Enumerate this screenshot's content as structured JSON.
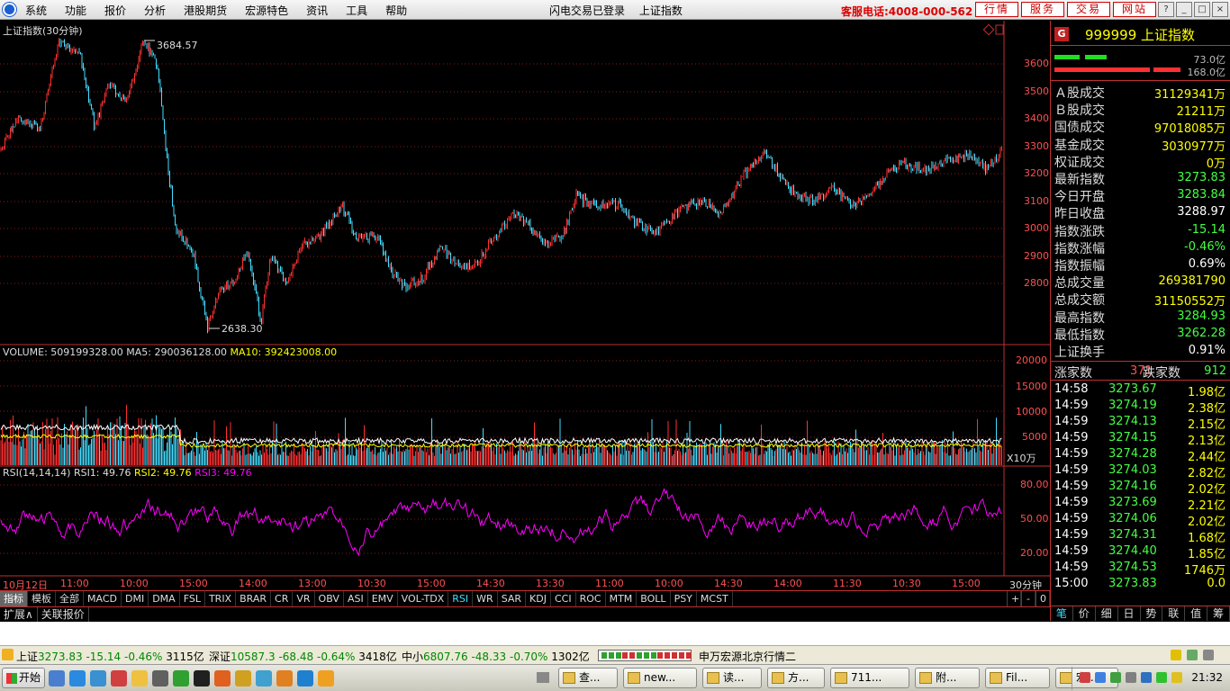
{
  "menu": {
    "items": [
      "系统",
      "功能",
      "报价",
      "分析",
      "港股期货",
      "宏源特色",
      "资讯",
      "工具",
      "帮助"
    ],
    "status": [
      "闪电交易已登录",
      "上证指数"
    ],
    "hotline": "客服电话:4008-000-562",
    "quick_buttons": [
      "行情",
      "服务",
      "交易",
      "网站"
    ],
    "window_controls": [
      "?",
      "_",
      "□",
      "×"
    ]
  },
  "chart": {
    "title": "上证指数(30分钟)",
    "price_axis": [
      "3600",
      "3500",
      "3400",
      "3300",
      "3200",
      "3100",
      "3000",
      "2900",
      "2800"
    ],
    "annotation_high": "3684.57",
    "annotation_low": "2638.30",
    "volume_header": {
      "prefix": "VOLUME: 509199328.00",
      "ma5": "MA5: 290036128.00",
      "ma10": "MA10: 392423008.00"
    },
    "volume_axis": [
      "20000",
      "15000",
      "10000",
      "5000"
    ],
    "volume_unit": "X10万",
    "rsi_header": {
      "prefix": "RSI(14,14,14)",
      "rsi1": "RSI1: 49.76",
      "rsi2": "RSI2: 49.76",
      "rsi3": "RSI3: 49.76"
    },
    "rsi_axis": [
      "80.00",
      "50.00",
      "20.00"
    ],
    "time_axis": [
      "10月12日",
      "11:00",
      "10:00",
      "15:00",
      "14:00",
      "13:00",
      "10:30",
      "15:00",
      "14:30",
      "13:30",
      "11:00",
      "10:00",
      "14:30",
      "14:00",
      "11:30",
      "10:30",
      "15:00"
    ],
    "period": "30分钟",
    "colors": {
      "up": "#ff3030",
      "down": "#44ddff",
      "ma5": "#ffffff",
      "ma10": "#ffff00",
      "rsi": "#ff00ff",
      "grid": "#8a1a1a"
    }
  },
  "indicators": {
    "tabs": [
      "指标",
      "模板",
      "全部",
      "MACD",
      "DMI",
      "DMA",
      "FSL",
      "TRIX",
      "BRAR",
      "CR",
      "VR",
      "OBV",
      "ASI",
      "EMV",
      "VOL-TDX",
      "RSI",
      "WR",
      "SAR",
      "KDJ",
      "CCI",
      "ROC",
      "MTM",
      "BOLL",
      "PSY",
      "MCST"
    ],
    "selected": "指标",
    "active": "RSI",
    "right_buttons": [
      "+",
      "-",
      "0"
    ]
  },
  "ext_tabs": [
    "扩展∧",
    "关联报价"
  ],
  "quote": {
    "code": "999999",
    "name": "上证指数",
    "buy_ratio": "73.0亿",
    "sell_ratio": "168.0亿",
    "rows": [
      {
        "k": "Ａ股成交",
        "v": "31129341万",
        "c": "yellow"
      },
      {
        "k": "Ｂ股成交",
        "v": "21211万",
        "c": "yellow"
      },
      {
        "k": "国债成交",
        "v": "97018085万",
        "c": "yellow"
      },
      {
        "k": "基金成交",
        "v": "3030977万",
        "c": "yellow"
      },
      {
        "k": "权证成交",
        "v": "0万",
        "c": "yellow"
      },
      {
        "k": "最新指数",
        "v": "3273.83",
        "c": "green"
      },
      {
        "k": "今日开盘",
        "v": "3283.84",
        "c": "green"
      },
      {
        "k": "昨日收盘",
        "v": "3288.97",
        "c": "white"
      },
      {
        "k": "指数涨跌",
        "v": "-15.14",
        "c": "green"
      },
      {
        "k": "指数涨幅",
        "v": "-0.46%",
        "c": "green"
      },
      {
        "k": "指数振幅",
        "v": "0.69%",
        "c": "white"
      },
      {
        "k": "总成交量",
        "v": "269381790",
        "c": "yellow"
      },
      {
        "k": "总成交额",
        "v": "31150552万",
        "c": "yellow"
      },
      {
        "k": "最高指数",
        "v": "3284.93",
        "c": "green"
      },
      {
        "k": "最低指数",
        "v": "3262.28",
        "c": "green"
      },
      {
        "k": "上证换手",
        "v": "0.91%",
        "c": "white"
      }
    ],
    "adv_label": "涨家数",
    "adv_value": "371",
    "dec_label": "跌家数",
    "dec_value": "912",
    "ticks": [
      {
        "t": "14:58",
        "p": "3273.67",
        "a": "1.98亿"
      },
      {
        "t": "14:59",
        "p": "3274.19",
        "a": "2.38亿"
      },
      {
        "t": "14:59",
        "p": "3274.13",
        "a": "2.15亿"
      },
      {
        "t": "14:59",
        "p": "3274.15",
        "a": "2.13亿"
      },
      {
        "t": "14:59",
        "p": "3274.28",
        "a": "2.44亿"
      },
      {
        "t": "14:59",
        "p": "3274.03",
        "a": "2.82亿"
      },
      {
        "t": "14:59",
        "p": "3274.16",
        "a": "2.02亿"
      },
      {
        "t": "14:59",
        "p": "3273.69",
        "a": "2.21亿"
      },
      {
        "t": "14:59",
        "p": "3274.06",
        "a": "2.02亿"
      },
      {
        "t": "14:59",
        "p": "3274.31",
        "a": "1.68亿"
      },
      {
        "t": "14:59",
        "p": "3274.40",
        "a": "1.85亿"
      },
      {
        "t": "14:59",
        "p": "3274.53",
        "a": "1746万"
      },
      {
        "t": "15:00",
        "p": "3273.83",
        "a": "0.0"
      }
    ],
    "tabs": [
      "笔",
      "价",
      "细",
      "日",
      "势",
      "联",
      "值",
      "筹"
    ]
  },
  "statusbar": {
    "sh_label": "上证",
    "sh_value": "3273.83",
    "sh_change": "-15.14",
    "sh_pct": "-0.46%",
    "sh_amount": "3115亿",
    "sz_label": "深证",
    "sz_value": "10587.3",
    "sz_change": "-68.48",
    "sz_pct": "-0.64%",
    "sz_amount": "3418亿",
    "zx_label": "中小",
    "zx_value": "6807.76",
    "zx_change": "-48.33",
    "zx_pct": "-0.70%",
    "zx_amount": "1302亿",
    "server": "申万宏源北京行情二"
  },
  "taskbar": {
    "start": "开始",
    "buttons": [
      "查...",
      "new...",
      "读...",
      "方...",
      "711...",
      "附...",
      "Fil...",
      "宏..."
    ],
    "clock": "21:32"
  }
}
